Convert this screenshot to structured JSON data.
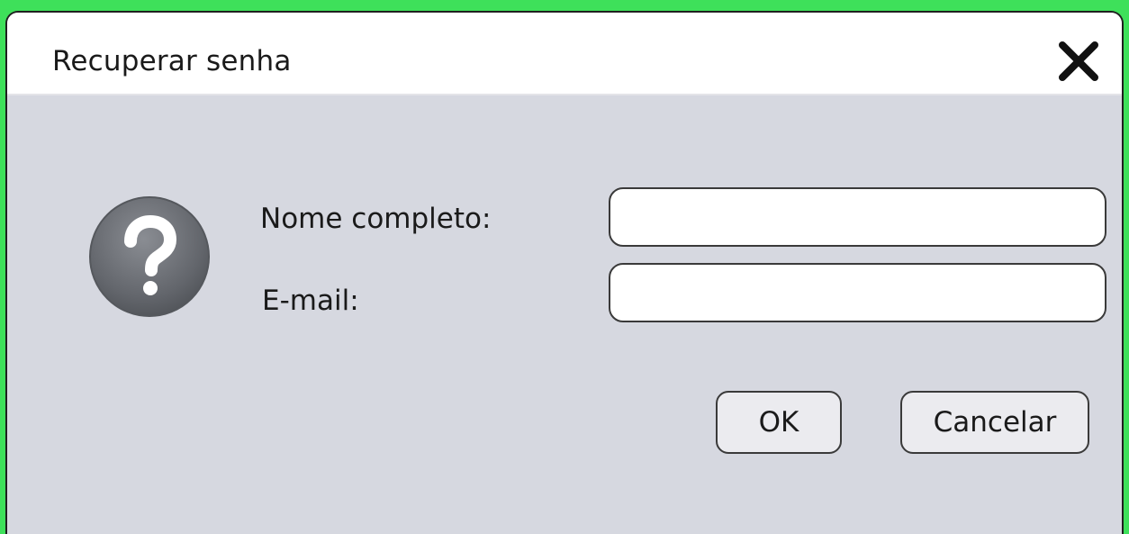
{
  "dialog": {
    "title": "Recuperar senha",
    "close_icon": "close-icon",
    "help_icon": "question-mark-icon"
  },
  "form": {
    "full_name_label": "Nome completo:",
    "full_name_value": "",
    "email_label": "E-mail:",
    "email_value": ""
  },
  "buttons": {
    "ok_label": "OK",
    "cancel_label": "Cancelar"
  },
  "colors": {
    "frame_border": "#3ee05a",
    "dialog_background": "#d6d8e0",
    "titlebar_background": "#ffffff",
    "icon_gray": "#6b6e74"
  }
}
